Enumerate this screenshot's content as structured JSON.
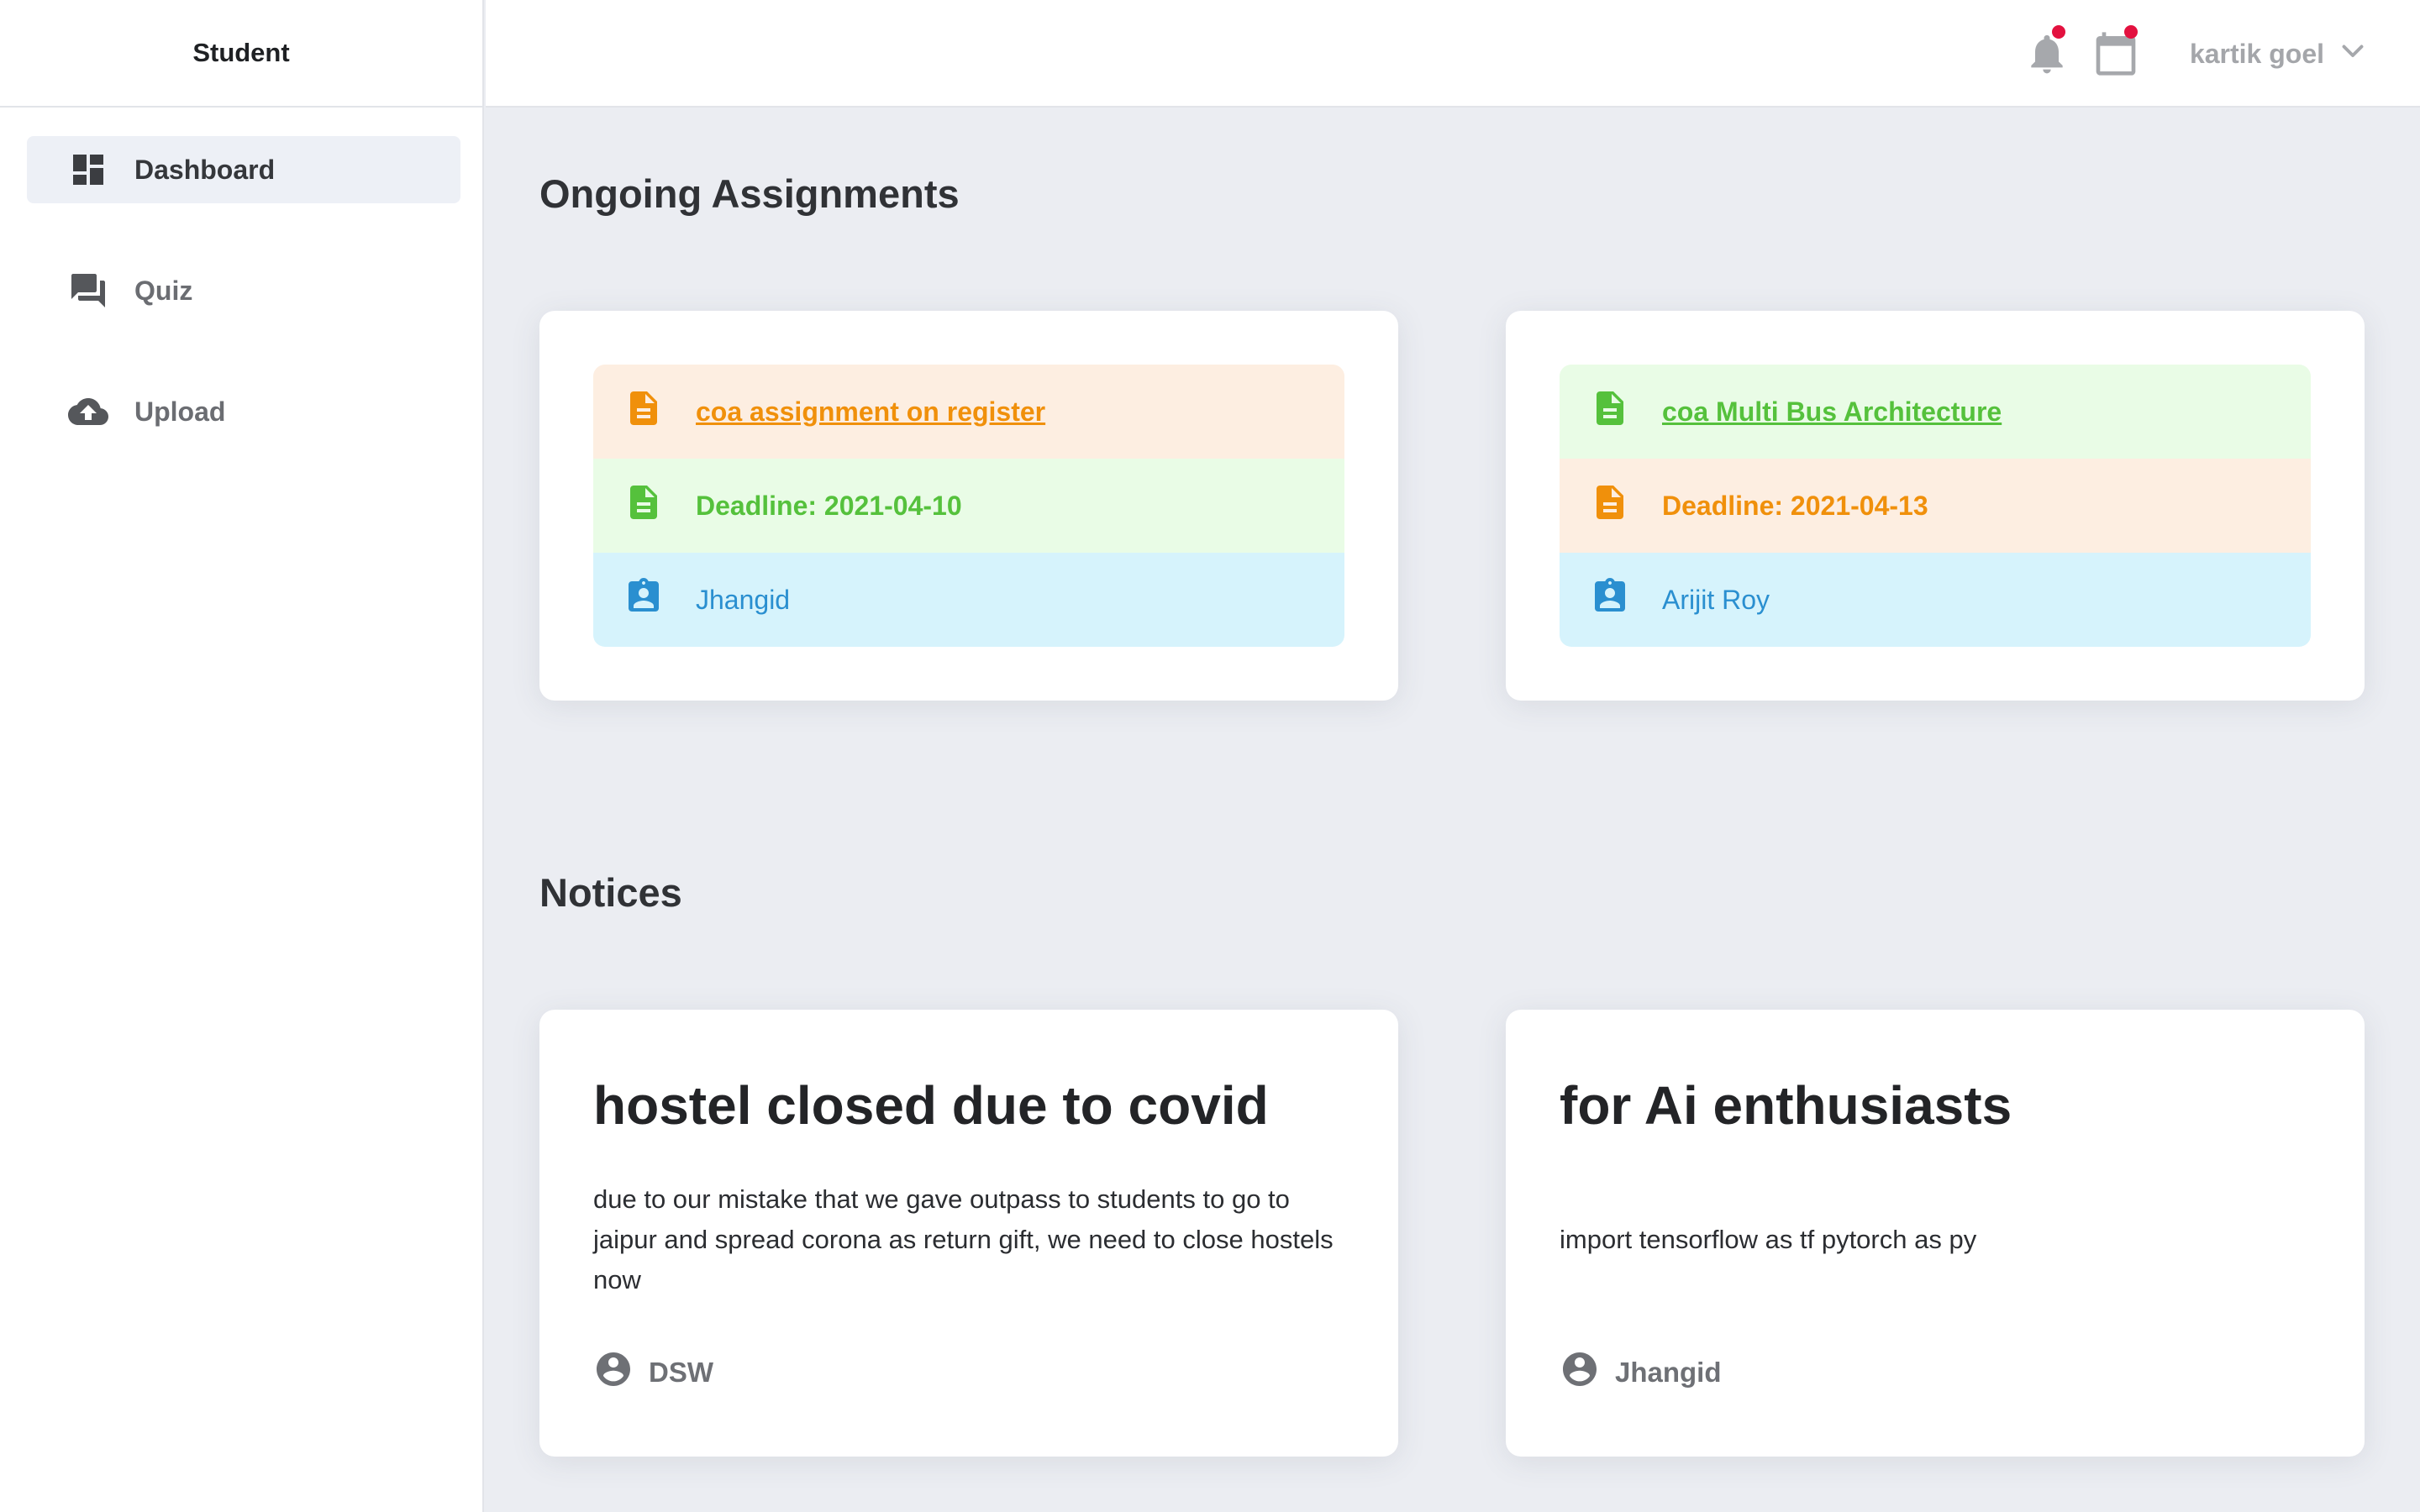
{
  "app": {
    "brand": "Student"
  },
  "sidebar": {
    "items": [
      {
        "label": "Dashboard",
        "icon": "dashboard-icon",
        "active": true
      },
      {
        "label": "Quiz",
        "icon": "forum-icon",
        "active": false
      },
      {
        "label": "Upload",
        "icon": "cloud-upload-icon",
        "active": false
      }
    ]
  },
  "topbar": {
    "notifications_icon": "bell-icon",
    "calendar_icon": "calendar-icon",
    "user_name": "kartik goel",
    "dropdown_icon": "chevron-down-icon"
  },
  "assignments": {
    "title": "Ongoing Assignments",
    "items": [
      {
        "name": "coa assignment on register",
        "deadline": "Deadline: 2021-04-10",
        "teacher": "Jhangid",
        "name_color": "#f0900b",
        "deadline_color": "#55c13c"
      },
      {
        "name": "coa Multi Bus Architecture",
        "deadline": "Deadline: 2021-04-13",
        "teacher": "Arijit Roy",
        "name_color": "#55c13c",
        "deadline_color": "#f0900b"
      }
    ]
  },
  "notices": {
    "title": "Notices",
    "items": [
      {
        "title": "hostel closed due to covid",
        "body": "due to our mistake that we gave outpass to students to go to jaipur and spread corona as return gift, we need to close hostels now",
        "author": "DSW"
      },
      {
        "title": "for Ai enthusiasts",
        "body": "import tensorflow as tf pytorch as py",
        "author": "Jhangid"
      }
    ]
  },
  "colors": {
    "orange": "#f0900b",
    "orange_bg": "#fdeee1",
    "green": "#55c13c",
    "green_bg": "#e9fce6",
    "blue": "#2a8fd0",
    "blue_bg": "#d6f3fc",
    "badge": "#e3113f"
  }
}
